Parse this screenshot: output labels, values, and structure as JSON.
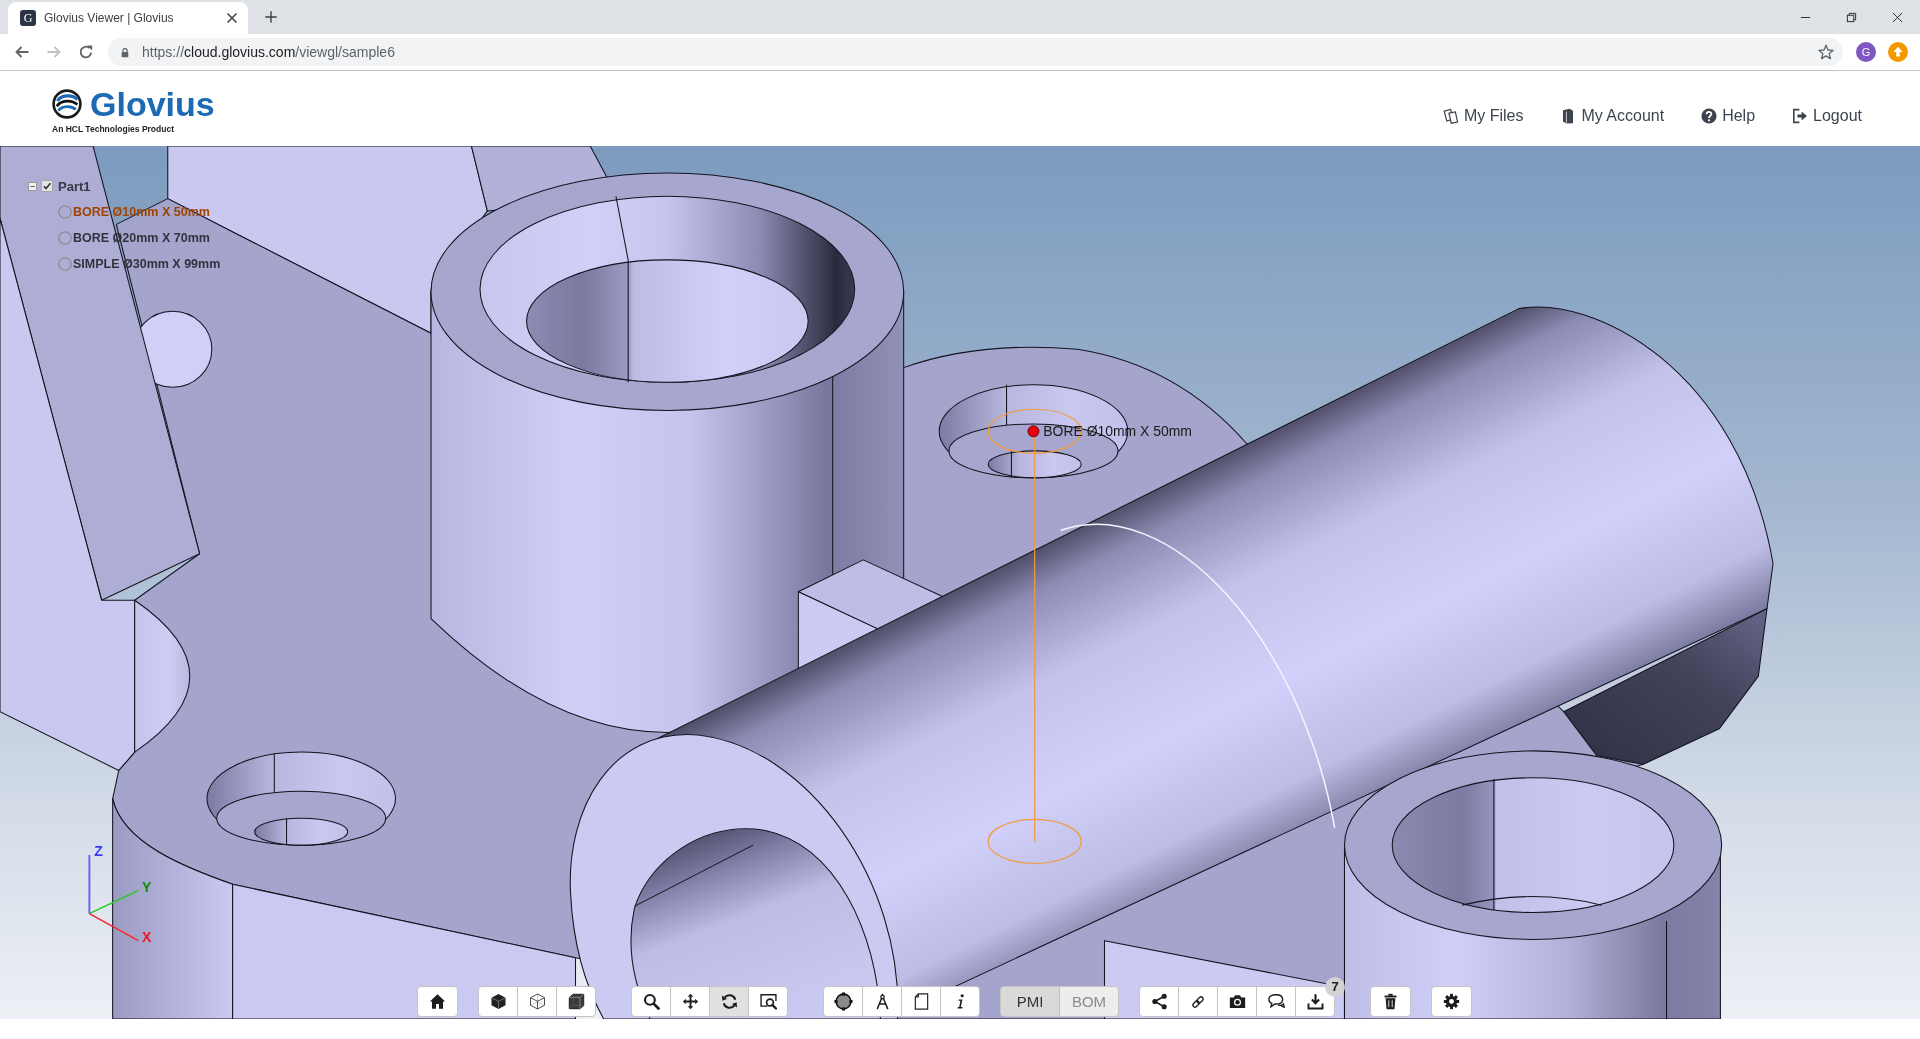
{
  "browser": {
    "tab": {
      "favicon_letter": "G",
      "title": "Glovius Viewer | Glovius",
      "selected": true
    },
    "nav_buttons": [
      {
        "kind": "back",
        "disabled": false
      },
      {
        "kind": "forward",
        "disabled": true
      },
      {
        "kind": "reload",
        "disabled": false
      }
    ],
    "address": {
      "scheme": "https://",
      "host": "cloud.glovius.com",
      "path": "/viewgl/sample6"
    },
    "profile_initial": "G"
  },
  "header": {
    "logo": {
      "wordmark": "Glovius",
      "tagline": "An HCL Technologies Product"
    },
    "nav": [
      {
        "label": "My Files"
      },
      {
        "label": "My Account"
      },
      {
        "label": "Help"
      },
      {
        "label": "Logout"
      }
    ]
  },
  "viewer": {
    "tree": {
      "label": "Part1",
      "checked": true,
      "expanded": true,
      "children": [
        {
          "label": "BORE Ø10mm X 50mm",
          "checked": false,
          "selected": true
        },
        {
          "label": "BORE Ø20mm X 70mm",
          "checked": false,
          "selected": false
        },
        {
          "label": "SIMPLE Ø30mm X 99mm",
          "checked": false,
          "selected": false
        }
      ]
    },
    "annotation": {
      "label": "BORE Ø10mm X 50mm"
    },
    "axes": {
      "z": "Z",
      "y": "Y",
      "x": "X"
    }
  },
  "toolbar": {
    "sections": [
      {
        "groups": [
          {
            "kind": "buttons",
            "buttons": [
              {
                "kind": "home",
                "active": false
              }
            ]
          },
          {
            "kind": "buttons",
            "buttons": [
              {
                "kind": "shaded",
                "active": false
              },
              {
                "kind": "wireframe",
                "active": false
              },
              {
                "kind": "edges",
                "active": false
              }
            ]
          }
        ]
      },
      {
        "groups": [
          {
            "kind": "buttons",
            "buttons": [
              {
                "kind": "zoom",
                "active": false
              },
              {
                "kind": "pan",
                "active": false
              },
              {
                "kind": "rotate",
                "active": true
              },
              {
                "kind": "fit",
                "active": false
              }
            ]
          }
        ]
      },
      {
        "groups": [
          {
            "kind": "buttons",
            "buttons": [
              {
                "kind": "handles",
                "active": false
              },
              {
                "kind": "measure",
                "active": false
              },
              {
                "kind": "sheet",
                "active": false
              },
              {
                "kind": "info",
                "active": false
              }
            ]
          },
          {
            "kind": "tabs",
            "tabs": [
              {
                "label": "PMI",
                "selected": true
              },
              {
                "label": "BOM",
                "selected": false
              }
            ]
          },
          {
            "kind": "buttons",
            "buttons": [
              {
                "kind": "share",
                "active": false
              },
              {
                "kind": "link",
                "active": false
              },
              {
                "kind": "camera",
                "active": false
              },
              {
                "kind": "comment",
                "active": false
              },
              {
                "kind": "download",
                "active": false,
                "badge": "7"
              }
            ]
          }
        ]
      },
      {
        "groups": [
          {
            "kind": "buttons",
            "buttons": [
              {
                "kind": "trash",
                "active": false
              }
            ]
          },
          {
            "kind": "buttons",
            "buttons": [
              {
                "kind": "gear",
                "active": false
              }
            ]
          }
        ]
      }
    ]
  }
}
